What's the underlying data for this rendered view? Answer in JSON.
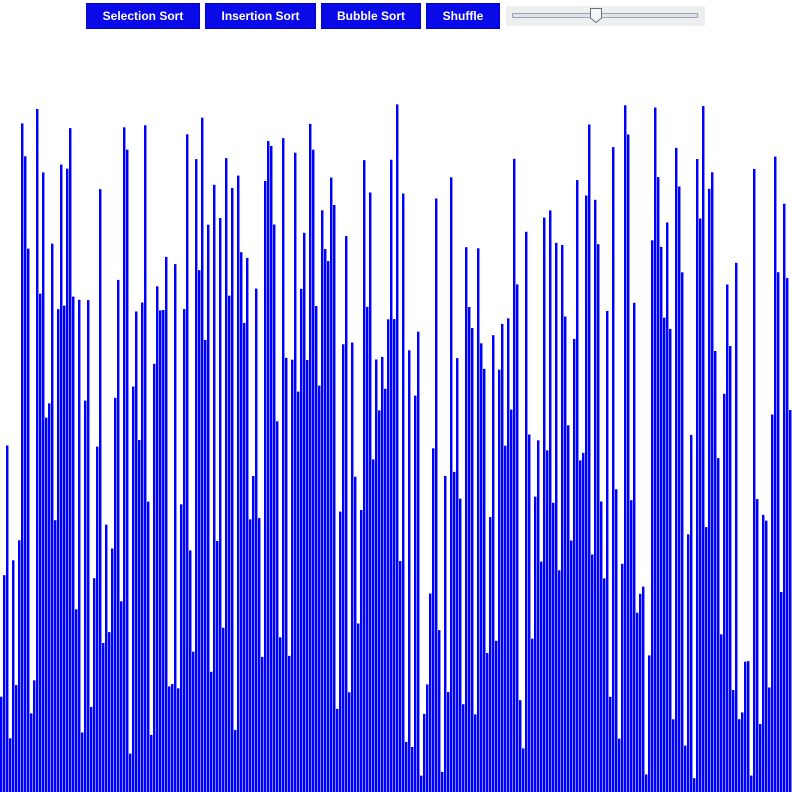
{
  "toolbar": {
    "buttons": [
      {
        "label": "Selection Sort"
      },
      {
        "label": "Insertion Sort"
      },
      {
        "label": "Bubble Sort"
      },
      {
        "label": "Shuffle"
      }
    ],
    "speed_slider": {
      "value": 0.45
    }
  },
  "colors": {
    "accent": "#0a0ae9",
    "bar": "#0000ff",
    "background": "#ffffff"
  },
  "array": {
    "count": 264,
    "min_value": 0,
    "max_value": 1,
    "seed": 7331
  }
}
